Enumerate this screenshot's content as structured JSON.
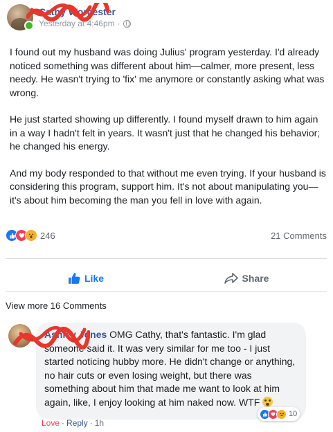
{
  "post": {
    "author_name": "Cathy Worcester",
    "timestamp": "Yesterday at 4:46pm",
    "separator": "·",
    "privacy_icon": "globe-icon",
    "body": [
      "I found out my husband was doing Julius' program yesterday. I'd already noticed something was different about him—calmer, more present, less needy. He wasn't trying to 'fix' me anymore or constantly asking what was wrong.",
      "He just started showing up differently. I found myself drawn to him again in a way I hadn't felt in years. It wasn't just that he changed his behavior; he changed his energy.",
      "And my body responded to that without me even trying. If your husband is considering this program, support him. It's not about manipulating you—it's about him becoming the man you fell in love with again."
    ],
    "reactions": {
      "icons": [
        "like-icon",
        "love-icon",
        "wow-icon"
      ],
      "count": "246"
    },
    "comments_count": "21 Comments"
  },
  "actions": {
    "like_label": "Like",
    "share_label": "Share"
  },
  "view_more_label": "View more 16 Comments",
  "comment": {
    "author_name": "Ashley Jones",
    "text": "OMG Cathy, that's fantastic. I'm glad someone said it. It was very similar for me too - I just started noticing hubby more. He didn't change or anything, no hair cuts or even losing weight, but there was something about him that made me want to look at him again, like, I enjoy looking at him naked now. WTF",
    "emoji": "flushed-face-emoji",
    "reactions": {
      "icons": [
        "like-icon",
        "love-icon",
        "haha-icon"
      ],
      "count": "10"
    },
    "actions": {
      "love_label": "Love",
      "dot": "·",
      "reply_label": "Reply",
      "age": "1h"
    }
  },
  "colors": {
    "link_blue": "#385898",
    "facebook_blue": "#1877f2",
    "love_red": "#f33e58",
    "online_green": "#42b72a",
    "comment_bg": "#f2f3f5",
    "redaction_red": "#e8362c"
  }
}
